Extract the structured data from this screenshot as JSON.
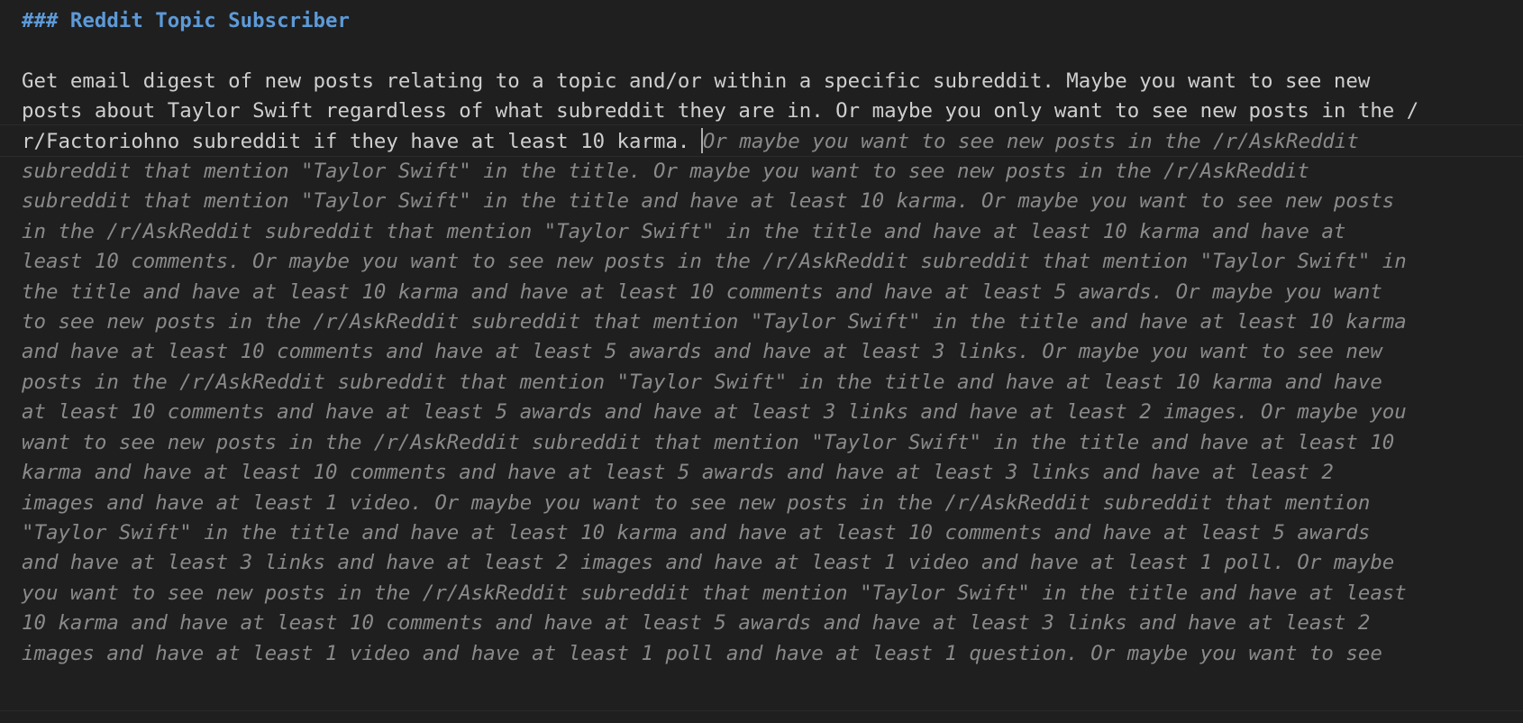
{
  "editor": {
    "heading": "### Reddit Topic Subscriber",
    "text_lines": [
      "Get email digest of new posts relating to a topic and/or within a specific subreddit. Maybe you want to see new",
      "posts about Taylor Swift regardless of what subreddit they are in. Or maybe you only want to see new posts in the /",
      "r/Factoriohno subreddit if they have at least 10 karma. "
    ],
    "suggestion_first": "Or maybe you want to see new posts in the /r/AskReddit",
    "suggestion_lines": [
      "subreddit that mention \"Taylor Swift\" in the title. Or maybe you want to see new posts in the /r/AskReddit",
      "subreddit that mention \"Taylor Swift\" in the title and have at least 10 karma. Or maybe you want to see new posts",
      "in the /r/AskReddit subreddit that mention \"Taylor Swift\" in the title and have at least 10 karma and have at",
      "least 10 comments. Or maybe you want to see new posts in the /r/AskReddit subreddit that mention \"Taylor Swift\" in",
      "the title and have at least 10 karma and have at least 10 comments and have at least 5 awards. Or maybe you want",
      "to see new posts in the /r/AskReddit subreddit that mention \"Taylor Swift\" in the title and have at least 10 karma",
      "and have at least 10 comments and have at least 5 awards and have at least 3 links. Or maybe you want to see new",
      "posts in the /r/AskReddit subreddit that mention \"Taylor Swift\" in the title and have at least 10 karma and have",
      "at least 10 comments and have at least 5 awards and have at least 3 links and have at least 2 images. Or maybe you",
      "want to see new posts in the /r/AskReddit subreddit that mention \"Taylor Swift\" in the title and have at least 10",
      "karma and have at least 10 comments and have at least 5 awards and have at least 3 links and have at least 2",
      "images and have at least 1 video. Or maybe you want to see new posts in the /r/AskReddit subreddit that mention",
      "\"Taylor Swift\" in the title and have at least 10 karma and have at least 10 comments and have at least 5 awards",
      "and have at least 3 links and have at least 2 images and have at least 1 video and have at least 1 poll. Or maybe",
      "you want to see new posts in the /r/AskReddit subreddit that mention \"Taylor Swift\" in the title and have at least",
      "10 karma and have at least 10 comments and have at least 5 awards and have at least 3 links and have at least 2",
      "images and have at least 1 video and have at least 1 poll and have at least 1 question. Or maybe you want to see"
    ]
  }
}
